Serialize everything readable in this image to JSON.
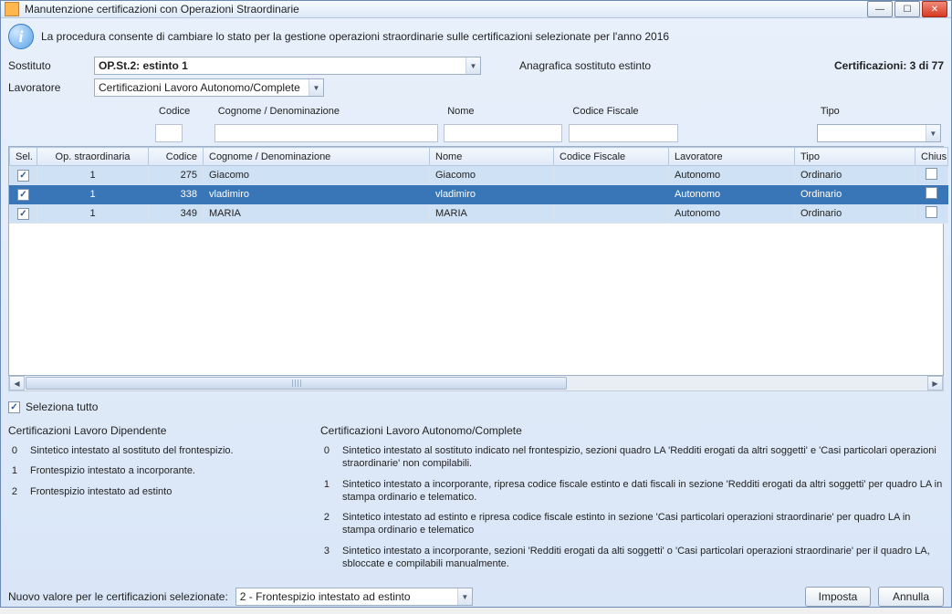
{
  "window": {
    "title": "Manutenzione certificazioni con Operazioni Straordinarie"
  },
  "info_text": "La procedura consente di cambiare lo stato per la gestione operazioni straordinarie sulle certificazioni selezionate per l'anno 2016",
  "form": {
    "sostituto_label": "Sostituto",
    "sostituto_value": "OP.St.2: estinto 1",
    "anagrafica_label": "Anagrafica sostituto estinto",
    "lavoratore_label": "Lavoratore",
    "lavoratore_value": "Certificazioni Lavoro Autonomo/Complete",
    "stats_label": "Certificazioni: 3 di 77"
  },
  "filters": {
    "codice": "Codice",
    "cognome": "Cognome / Denominazione",
    "nome": "Nome",
    "codice_fiscale": "Codice Fiscale",
    "tipo": "Tipo"
  },
  "grid": {
    "headers": {
      "sel": "Sel.",
      "op": "Op. straordinaria",
      "codice": "Codice",
      "cognome": "Cognome / Denominazione",
      "nome": "Nome",
      "cf": "Codice Fiscale",
      "lavoratore": "Lavoratore",
      "tipo": "Tipo",
      "chius": "Chius"
    },
    "rows": [
      {
        "sel": true,
        "op": "1",
        "codice": "275",
        "cognome": "Giacomo",
        "nome": "Giacomo",
        "cf": "",
        "lavoratore": "Autonomo",
        "tipo": "Ordinario",
        "chius": false,
        "selected_row": false
      },
      {
        "sel": true,
        "op": "1",
        "codice": "338",
        "cognome": "vladimiro",
        "nome": "vladimiro",
        "cf": "",
        "lavoratore": "Autonomo",
        "tipo": "Ordinario",
        "chius": false,
        "selected_row": true
      },
      {
        "sel": true,
        "op": "1",
        "codice": "349",
        "cognome": "MARIA",
        "nome": "MARIA",
        "cf": "",
        "lavoratore": "Autonomo",
        "tipo": "Ordinario",
        "chius": false,
        "selected_row": false
      }
    ]
  },
  "select_all": {
    "checked": true,
    "label": "Seleziona tutto"
  },
  "legend": {
    "left_title": "Certificazioni Lavoro Dipendente",
    "left_items": [
      {
        "idx": "0",
        "txt": "Sintetico intestato al sostituto del frontespizio."
      },
      {
        "idx": "1",
        "txt": "Frontespizio intestato a incorporante."
      },
      {
        "idx": "2",
        "txt": "Frontespizio intestato ad estinto"
      }
    ],
    "right_title": "Certificazioni Lavoro Autonomo/Complete",
    "right_items": [
      {
        "idx": "0",
        "txt": "Sintetico intestato al sostituto indicato nel frontespizio, sezioni quadro LA 'Redditi erogati da altri soggetti' e 'Casi particolari operazioni straordinarie' non compilabili."
      },
      {
        "idx": "1",
        "txt": "Sintetico intestato a incorporante, ripresa codice fiscale estinto e dati fiscali in sezione 'Redditi erogati da altri soggetti' per quadro LA in stampa ordinario e telematico."
      },
      {
        "idx": "2",
        "txt": "Sintetico intestato ad estinto e ripresa codice fiscale estinto in sezione 'Casi particolari operazioni straordinarie' per quadro LA in stampa ordinario e telematico"
      },
      {
        "idx": "3",
        "txt": "Sintetico intestato a incorporante, sezioni 'Redditi erogati da alti soggetti' o 'Casi particolari operazioni straordinarie' per il quadro LA, sbloccate e compilabili manualmente."
      }
    ]
  },
  "footer": {
    "label": "Nuovo valore per le certificazioni selezionate:",
    "dropdown_value": "2 - Frontespizio intestato ad estinto",
    "imposta": "Imposta",
    "annulla": "Annulla"
  }
}
